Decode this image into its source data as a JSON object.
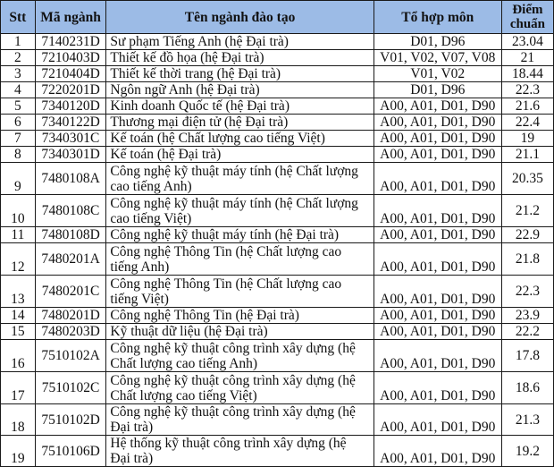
{
  "table": {
    "header_color": "#9cbbe6",
    "headers": {
      "stt": "Stt",
      "code": "Mã ngành",
      "name": "Tên ngành đào tạo",
      "combo": "Tổ hợp môn",
      "score_line1": "Điểm",
      "score_line2": "chuẩn"
    },
    "rows": [
      {
        "stt": "1",
        "code": "7140231D",
        "name": "Sư phạm Tiếng Anh (hệ Đại trà)",
        "combo": "D01, D96",
        "score": "23.04"
      },
      {
        "stt": "2",
        "code": "7210403D",
        "name": "Thiết kế đồ họa (hệ Đại trà)",
        "combo": "V01, V02, V07, V08",
        "score": "21"
      },
      {
        "stt": "3",
        "code": "7210404D",
        "name": "Thiết kế thời trang (hệ Đại trà)",
        "combo": "V01, V02",
        "score": "18.44"
      },
      {
        "stt": "4",
        "code": "7220201D",
        "name": "Ngôn ngữ Anh (hệ Đại trà)",
        "combo": "D01, D96",
        "score": "22.3"
      },
      {
        "stt": "5",
        "code": "7340120D",
        "name": "Kinh doanh Quốc tế (hệ Đại trà)",
        "combo": "A00, A01, D01, D90",
        "score": "21.6"
      },
      {
        "stt": "6",
        "code": "7340122D",
        "name": "Thương mại điện tử (hệ Đại trà)",
        "combo": "A00, A01, D01, D90",
        "score": "22.4"
      },
      {
        "stt": "7",
        "code": "7340301C",
        "name": "Kế toán (hệ Chất lượng cao tiếng Việt)",
        "combo": "A00, A01, D01, D90",
        "score": "19"
      },
      {
        "stt": "8",
        "code": "7340301D",
        "name": "Kế toán (hệ Đại trà)",
        "combo": "A00, A01, D01, D90",
        "score": "21.1"
      },
      {
        "stt": "9",
        "code": "7480108A",
        "name": "Công nghệ kỹ thuật máy tính (hệ Chất lượng cao tiếng Anh)",
        "combo": "A00, A01, D01, D90",
        "score": "20.35"
      },
      {
        "stt": "10",
        "code": "7480108C",
        "name": "Công nghệ kỹ thuật máy tính (hệ Chất lượng cao tiếng Việt)",
        "combo": "A00, A01, D01, D90",
        "score": "21.2"
      },
      {
        "stt": "11",
        "code": "7480108D",
        "name": "Công nghệ kỹ thuật máy tính (hệ Đại trà)",
        "combo": "A00, A01, D01, D90",
        "score": "22.9"
      },
      {
        "stt": "12",
        "code": "7480201A",
        "name": "Công nghệ Thông Tin (hệ Chất lượng cao tiếng Anh)",
        "combo": "A00, A01, D01, D90",
        "score": "21.8"
      },
      {
        "stt": "13",
        "code": "7480201C",
        "name": "Công nghệ Thông Tin (hệ Chất lượng cao tiếng Việt)",
        "combo": "A00, A01, D01, D90",
        "score": "22.3"
      },
      {
        "stt": "14",
        "code": "7480201D",
        "name": "Công nghệ Thông Tin (hệ Đại trà)",
        "combo": "A00, A01, D01, D90",
        "score": "23.9"
      },
      {
        "stt": "15",
        "code": "7480203D",
        "name": "Kỹ thuật dữ liệu (hệ Đại trà)",
        "combo": "A00, A01, D01, D90",
        "score": "22.2"
      },
      {
        "stt": "16",
        "code": "7510102A",
        "name": "Công nghệ kỹ thuật công trình xây dựng (hệ Chất lượng cao tiếng Anh)",
        "combo": "A00, A01, D01, D90",
        "score": "17.8"
      },
      {
        "stt": "17",
        "code": "7510102C",
        "name": "Công nghệ kỹ thuật công trình xây dựng (hệ Chất lượng cao tiếng Việt)",
        "combo": "A00, A01, D01, D90",
        "score": "18.6"
      },
      {
        "stt": "18",
        "code": "7510102D",
        "name": "Công nghệ kỹ thuật công trình xây dựng (hệ Đại trà)",
        "combo": "A00, A01, D01, D90",
        "score": "21.3"
      },
      {
        "stt": "19",
        "code": "7510106D",
        "name": "Hệ thống kỹ thuật công trình xây dựng (hệ Đại trà)",
        "combo": "A00, A01, D01, D90",
        "score": "19.2"
      }
    ]
  }
}
